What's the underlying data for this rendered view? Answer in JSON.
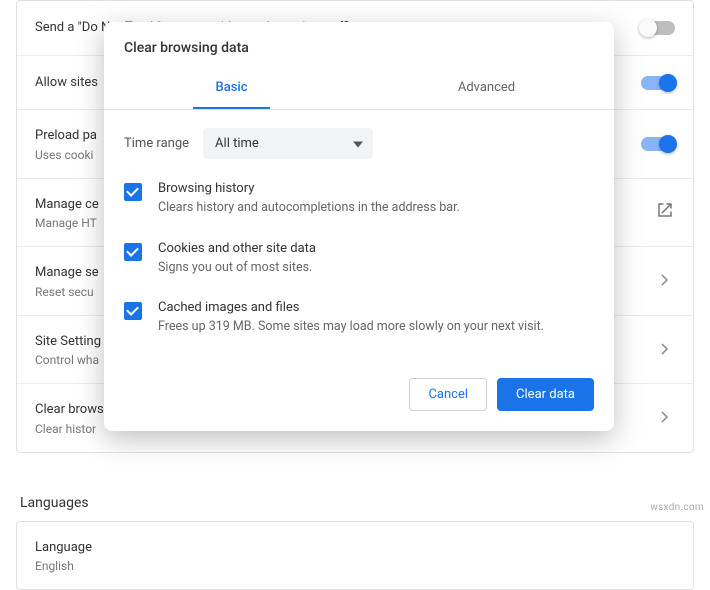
{
  "settings": {
    "rows": [
      {
        "title": "Send a \"Do Not Track\" request with your browsing traffic",
        "sub": "",
        "control": "toggle-off"
      },
      {
        "title": "Allow sites",
        "sub": "",
        "control": "toggle-on"
      },
      {
        "title": "Preload pa",
        "sub": "Uses cooki",
        "control": "toggle-on"
      },
      {
        "title": "Manage ce",
        "sub": "Manage HT",
        "control": "external"
      },
      {
        "title": "Manage se",
        "sub": "Reset secu",
        "control": "chevron"
      },
      {
        "title": "Site Setting",
        "sub": "Control wha",
        "control": "chevron"
      },
      {
        "title": "Clear brows",
        "sub": "Clear histor",
        "control": "chevron"
      }
    ],
    "languages_label": "Languages",
    "language_row": {
      "title": "Language",
      "sub": "English"
    }
  },
  "dialog": {
    "title": "Clear browsing data",
    "tabs": {
      "basic": "Basic",
      "advanced": "Advanced"
    },
    "time_range_label": "Time range",
    "time_range_value": "All time",
    "options": [
      {
        "title": "Browsing history",
        "sub": "Clears history and autocompletions in the address bar."
      },
      {
        "title": "Cookies and other site data",
        "sub": "Signs you out of most sites."
      },
      {
        "title": "Cached images and files",
        "sub": "Frees up 319 MB. Some sites may load more slowly on your next visit."
      }
    ],
    "cancel": "Cancel",
    "clear": "Clear data"
  },
  "watermark": "wsxdn.com"
}
